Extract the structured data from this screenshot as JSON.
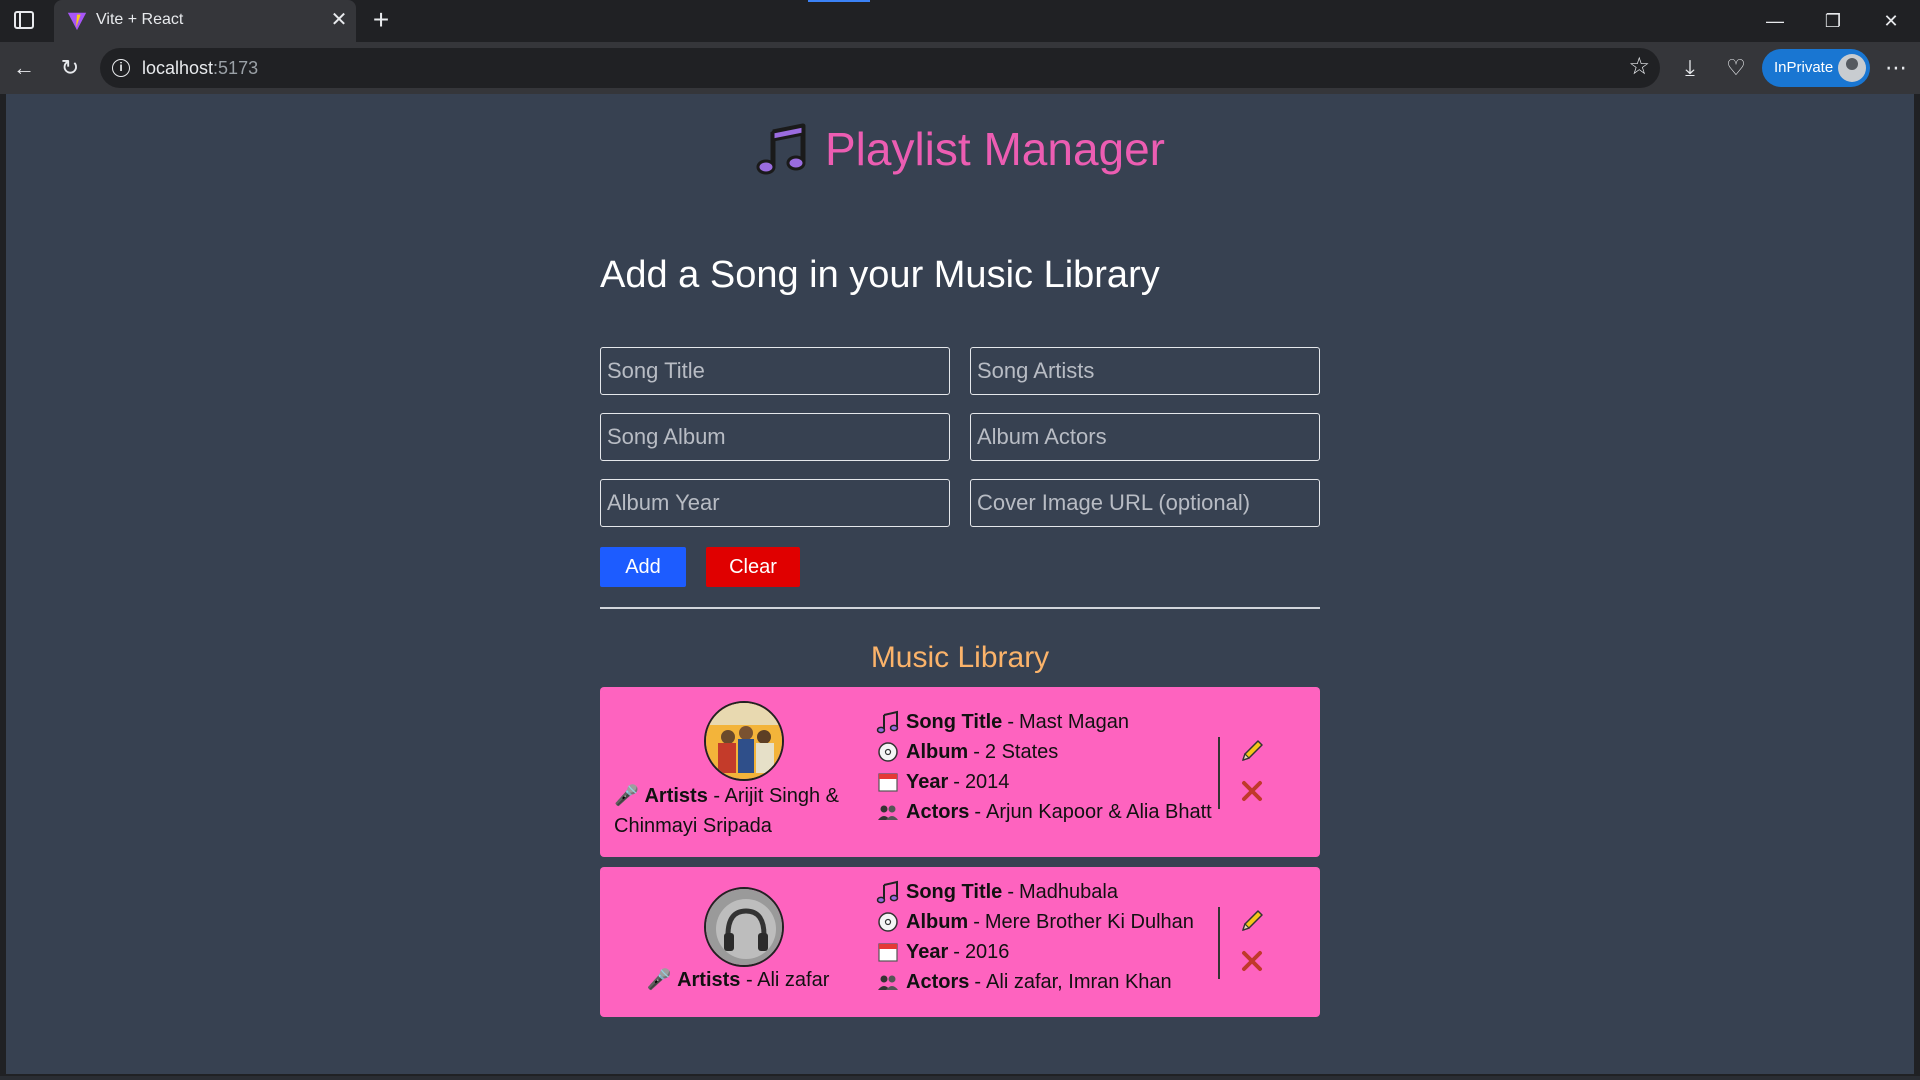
{
  "browser": {
    "tab_title": "Vite + React",
    "url_host": "localhost",
    "url_port": ":5173",
    "inprivate_label": "InPrivate"
  },
  "header": {
    "title": "Playlist Manager"
  },
  "form": {
    "title": "Add a Song in your Music Library",
    "song_title_placeholder": "Song Title",
    "song_artists_placeholder": "Song Artists",
    "song_album_placeholder": "Song Album",
    "album_actors_placeholder": "Album Actors",
    "album_year_placeholder": "Album Year",
    "cover_url_placeholder": "Cover Image URL (optional)",
    "add_label": "Add",
    "clear_label": "Clear"
  },
  "library": {
    "title": "Music Library",
    "labels": {
      "artists": "Artists",
      "song_title": "Song Title",
      "album": "Album",
      "year": "Year",
      "actors": "Actors",
      "separator": "-"
    },
    "songs": [
      {
        "artists": "Arijit Singh & Chinmayi Sripada",
        "song_title": "Mast Magan",
        "album": "2 States",
        "year": "2014",
        "actors": "Arjun Kapoor & Alia Bhatt"
      },
      {
        "artists": "Ali zafar",
        "song_title": "Madhubala",
        "album": "Mere Brother Ki Dulhan",
        "year": "2016",
        "actors": "Ali zafar, Imran Khan"
      }
    ]
  },
  "colors": {
    "page_bg": "#374151",
    "title_pink": "#ec5db2",
    "library_title": "#fbb36a",
    "card_bg": "#fe63bf",
    "add_button": "#1d5cff",
    "clear_button": "#e00000"
  }
}
